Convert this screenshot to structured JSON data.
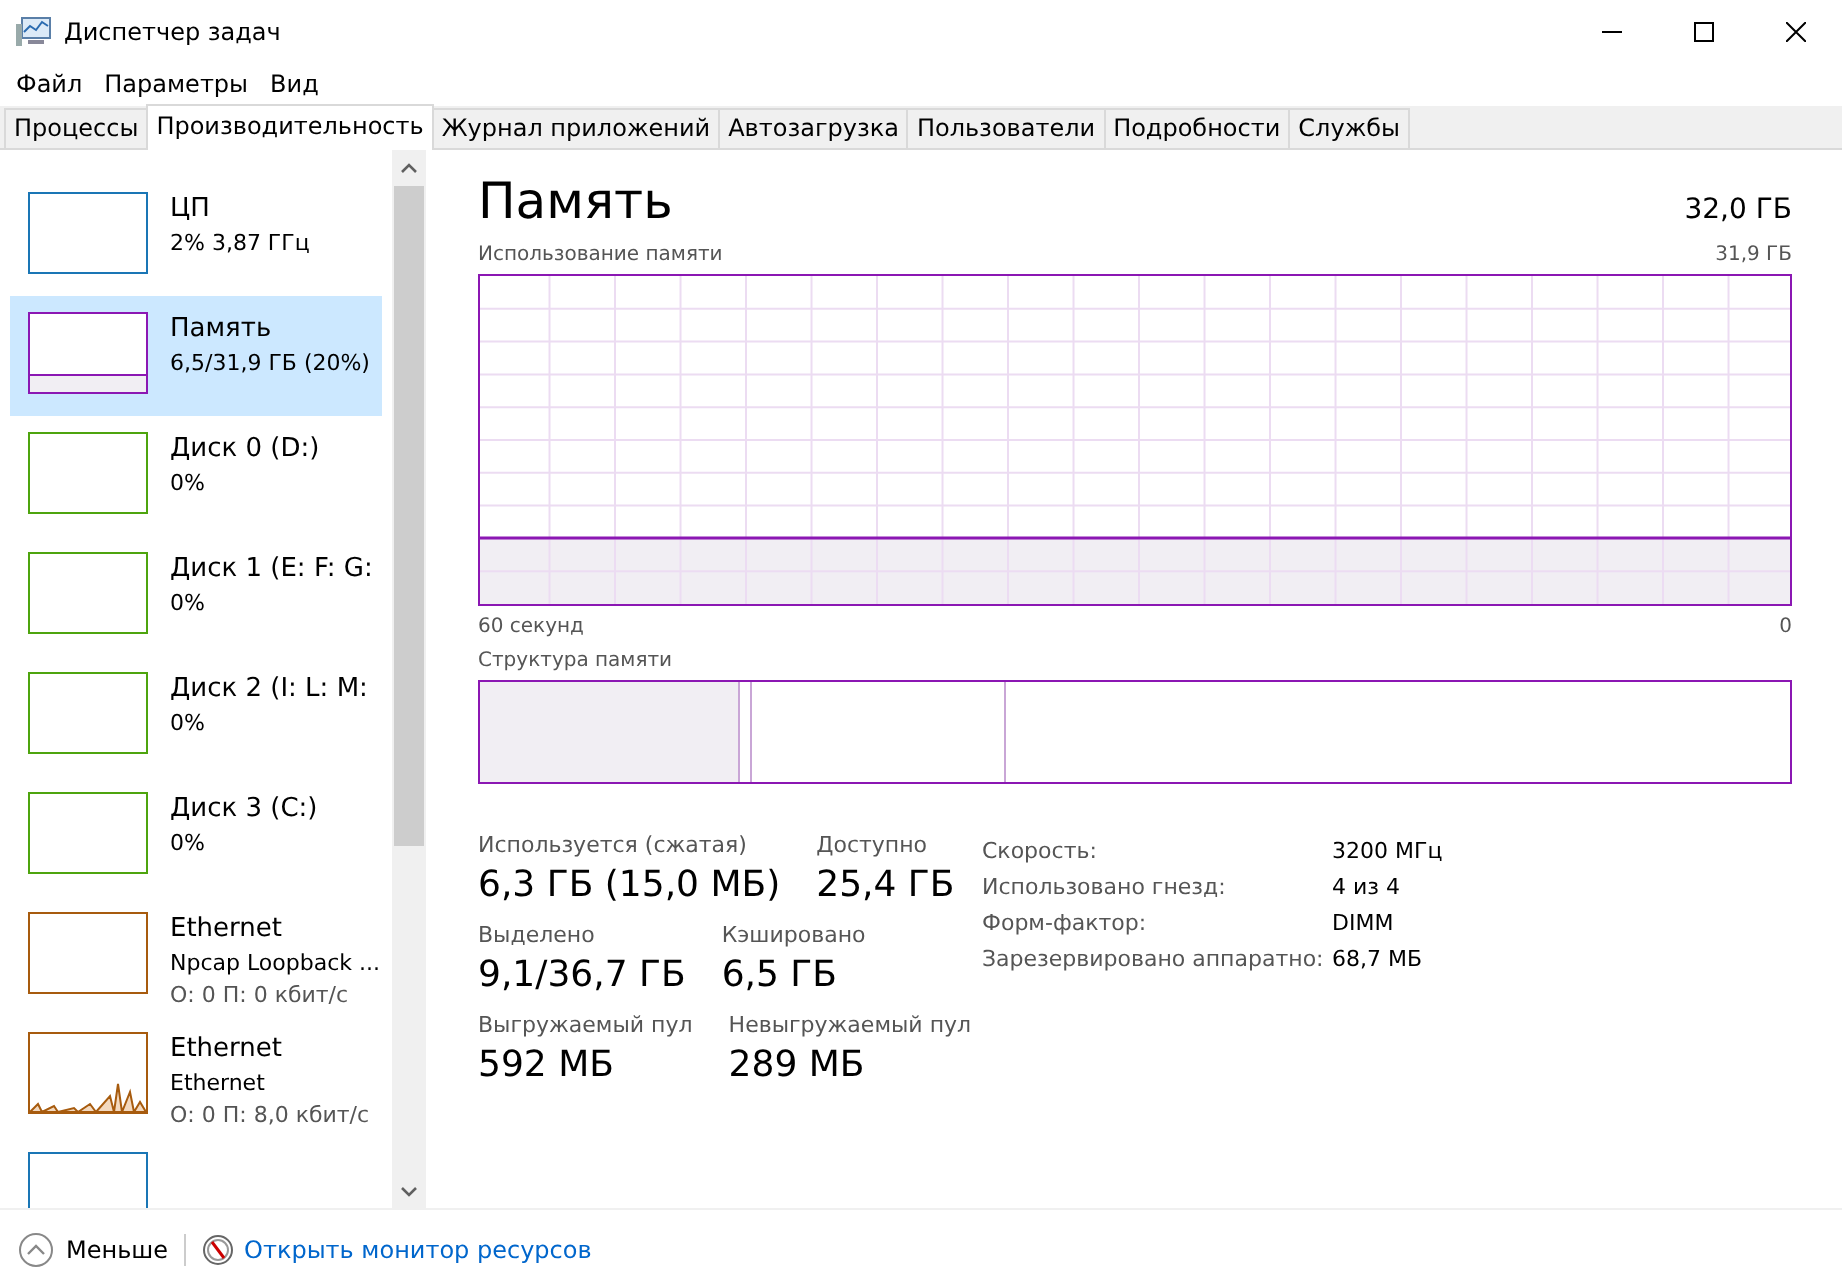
{
  "window": {
    "title": "Диспетчер задач"
  },
  "menu": [
    "Файл",
    "Параметры",
    "Вид"
  ],
  "tabs": [
    {
      "label": "Процессы",
      "selected": false
    },
    {
      "label": "Производительность",
      "selected": true
    },
    {
      "label": "Журнал приложений",
      "selected": false
    },
    {
      "label": "Автозагрузка",
      "selected": false
    },
    {
      "label": "Пользователи",
      "selected": false
    },
    {
      "label": "Подробности",
      "selected": false
    },
    {
      "label": "Службы",
      "selected": false
    }
  ],
  "sidebar": {
    "items": [
      {
        "kind": "cpu",
        "color": "#1a76b5",
        "title": "ЦП",
        "lines": [
          "2% 3,87 ГГц"
        ],
        "selected": false
      },
      {
        "kind": "memory",
        "color": "#8b17b3",
        "title": "Память",
        "lines": [
          "6,5/31,9 ГБ (20%)"
        ],
        "selected": true
      },
      {
        "kind": "disk",
        "color": "#4ea40e",
        "title": "Диск 0 (D:)",
        "lines": [
          "0%"
        ],
        "selected": false
      },
      {
        "kind": "disk",
        "color": "#4ea40e",
        "title": "Диск 1 (E: F: G:",
        "lines": [
          "0%"
        ],
        "selected": false
      },
      {
        "kind": "disk",
        "color": "#4ea40e",
        "title": "Диск 2 (I: L: M:",
        "lines": [
          "0%"
        ],
        "selected": false
      },
      {
        "kind": "disk",
        "color": "#4ea40e",
        "title": "Диск 3 (C:)",
        "lines": [
          "0%"
        ],
        "selected": false
      },
      {
        "kind": "network",
        "color": "#a75b0e",
        "title": "Ethernet",
        "lines": [
          "Npcap Loopback ...",
          "О: 0 П: 0 кбит/с"
        ],
        "traffic": false,
        "selected": false
      },
      {
        "kind": "network",
        "color": "#a75b0e",
        "title": "Ethernet",
        "lines": [
          "Ethernet",
          "О: 0 П: 8,0 кбит/с"
        ],
        "traffic": true,
        "selected": false
      },
      {
        "kind": "gpu",
        "color": "#1a76b5",
        "selected": false
      }
    ]
  },
  "panel": {
    "title": "Память",
    "total": "32,0 ГБ",
    "usage_label": "Использование памяти",
    "usage_max": "31,9 ГБ",
    "x_start": "60 секунд",
    "x_end": "0",
    "structure_label": "Структура памяти",
    "stats": [
      [
        {
          "label": "Используется (сжатая)",
          "value": "6,3 ГБ (15,0 МБ)"
        },
        {
          "label": "Доступно",
          "value": "25,4 ГБ"
        }
      ],
      [
        {
          "label": "Выделено",
          "value": "9,1/36,7 ГБ"
        },
        {
          "label": "Кэшировано",
          "value": "6,5 ГБ"
        }
      ],
      [
        {
          "label": "Выгружаемый пул",
          "value": "592 МБ"
        },
        {
          "label": "Невыгружаемый пул",
          "value": "289 МБ"
        }
      ]
    ],
    "details": [
      {
        "label": "Скорость:",
        "value": "3200 МГц"
      },
      {
        "label": "Использовано гнезд:",
        "value": "4 из 4"
      },
      {
        "label": "Форм-фактор:",
        "value": "DIMM"
      },
      {
        "label": "Зарезервировано аппаратно:",
        "value": "68,7 МБ"
      }
    ]
  },
  "footer": {
    "less": "Меньше",
    "monitor_link": "Открыть монитор ресурсов"
  }
}
